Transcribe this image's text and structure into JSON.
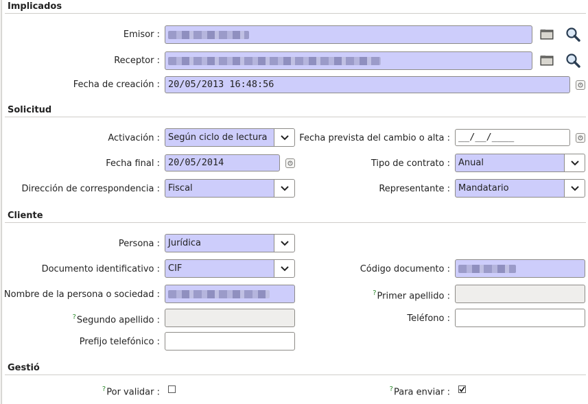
{
  "sections": {
    "implicados": "Implicados",
    "solicitud": "Solicitud",
    "cliente": "Cliente",
    "gestio": "Gestió"
  },
  "implicados": {
    "emisor_label": "Emisor :",
    "receptor_label": "Receptor :",
    "fecha_creacion_label": "Fecha de creación :",
    "fecha_creacion_value": "20/05/2013 16:48:56"
  },
  "solicitud": {
    "activacion_label": "Activación :",
    "activacion_value": "Según ciclo de lectura",
    "fecha_prevista_label": "Fecha prevista del cambio o alta :",
    "fecha_prevista_value": "__/__/____",
    "fecha_final_label": "Fecha final :",
    "fecha_final_value": "20/05/2014",
    "tipo_contrato_label": "Tipo de contrato :",
    "tipo_contrato_value": "Anual",
    "direccion_label": "Dirección de correspondencia :",
    "direccion_value": "Fiscal",
    "representante_label": "Representante :",
    "representante_value": "Mandatario"
  },
  "cliente": {
    "persona_label": "Persona :",
    "persona_value": "Jurídica",
    "documento_label": "Documento identificativo :",
    "documento_value": "CIF",
    "codigo_label": "Código documento :",
    "nombre_label": "Nombre de la persona o sociedad :",
    "help_mark": "?",
    "primer_apellido_label": "Primer apellido :",
    "segundo_apellido_label": "Segundo apellido :",
    "telefono_label": "Teléfono :",
    "prefijo_label": "Prefijo telefónico :"
  },
  "gestio": {
    "por_validar_label": "Por validar :",
    "por_validar_checked": false,
    "para_enviar_label": "Para enviar :",
    "para_enviar_checked": true
  },
  "colors": {
    "required_field": "#cdcdfb",
    "readonly_field": "#efeeec",
    "background": "#ffffff"
  }
}
